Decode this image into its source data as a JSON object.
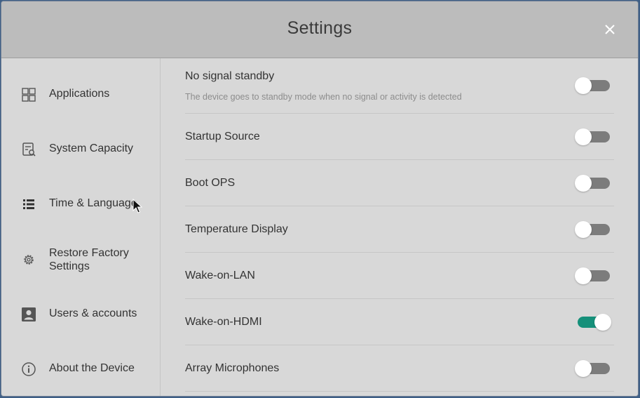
{
  "window": {
    "title": "Settings",
    "close_icon": "close-icon"
  },
  "sidebar": {
    "items": [
      {
        "label": "Applications",
        "icon": "grid-icon"
      },
      {
        "label": "System Capacity",
        "icon": "storage-icon"
      },
      {
        "label": "Time & Language",
        "icon": "list-icon"
      },
      {
        "label": "Restore Factory Settings",
        "icon": "gear-icon"
      },
      {
        "label": "Users & accounts",
        "icon": "account-icon"
      },
      {
        "label": "About the Device",
        "icon": "info-icon"
      }
    ]
  },
  "settings": [
    {
      "label": "No signal standby",
      "description": "The device goes to standby mode when no signal or activity is detected",
      "enabled": false
    },
    {
      "label": "Startup Source",
      "enabled": false
    },
    {
      "label": "Boot OPS",
      "enabled": false
    },
    {
      "label": "Temperature Display",
      "enabled": false
    },
    {
      "label": "Wake-on-LAN",
      "enabled": false
    },
    {
      "label": "Wake-on-HDMI",
      "enabled": true
    },
    {
      "label": "Array Microphones",
      "enabled": false
    }
  ],
  "colors": {
    "toggle_on": "#15907a",
    "toggle_off": "#7c7c7c",
    "panel_bg": "#d8d8d8",
    "titlebar_bg": "#bcbcbc"
  }
}
